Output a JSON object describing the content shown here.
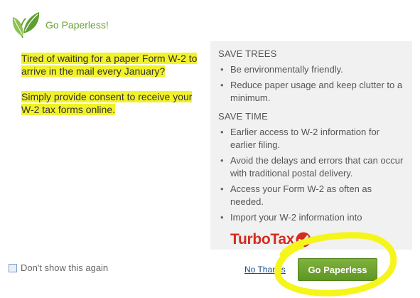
{
  "header": {
    "title": "Go Paperless!",
    "logo_icon": "leaf-logo-icon"
  },
  "intro": {
    "paragraph1": [
      "Tired of waiting for a paper Form W-2 to",
      "arrive in the mail every January?"
    ],
    "paragraph2": [
      "Simply provide consent to receive your",
      "W-2 tax forms online."
    ]
  },
  "panel": {
    "sections": [
      {
        "title": "SAVE TREES",
        "items": [
          "Be environmentally friendly.",
          "Reduce paper usage and keep clutter to a minimum."
        ]
      },
      {
        "title": "SAVE TIME",
        "items": [
          "Earlier access to W-2 information for earlier filing.",
          "Avoid the delays and errors that can occur with traditional postal delivery.",
          "Access your Form W-2 as often as needed.",
          "Import your W-2 information into"
        ]
      }
    ],
    "turbotax_logo_text": "TurboTax"
  },
  "footer": {
    "checkbox_label": "Don't show this again",
    "checkbox_checked": false,
    "no_thanks_label": "No Thanks",
    "primary_label": "Go Paperless"
  },
  "colors": {
    "brand_green": "#6aa232",
    "highlight_yellow": "#f2f22a",
    "panel_bg": "#f1f1f1",
    "turbotax_red": "#d52b1e",
    "link_blue": "#1d4b8f"
  }
}
